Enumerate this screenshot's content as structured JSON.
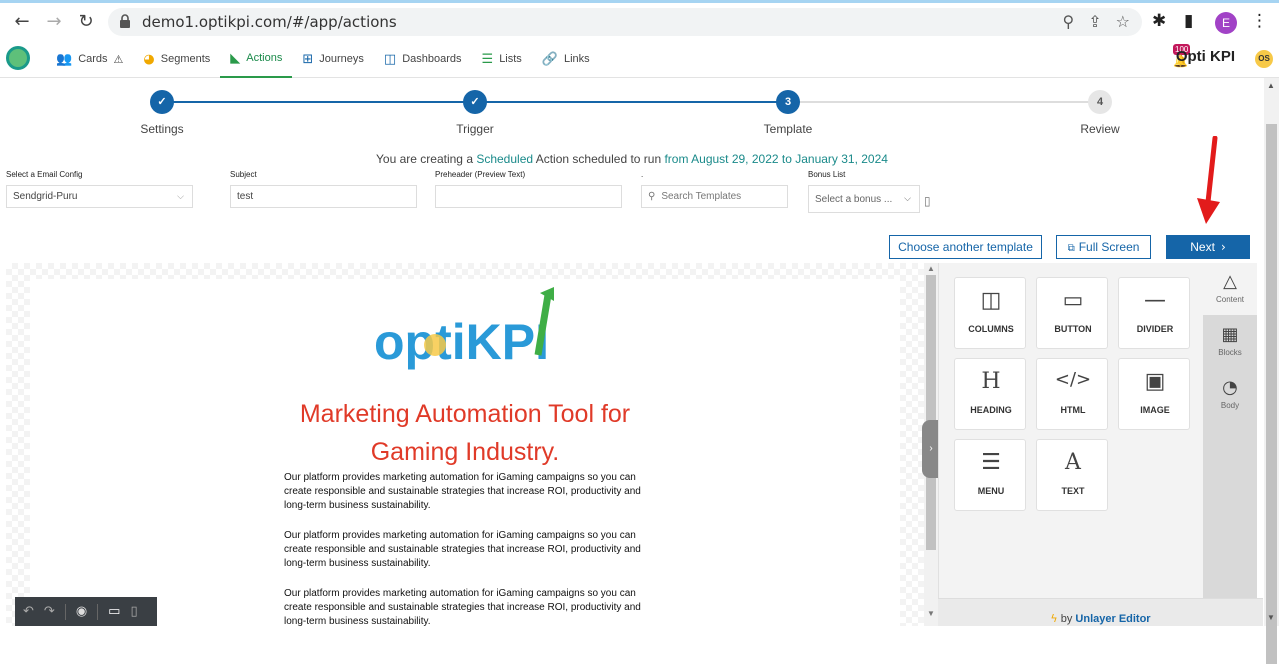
{
  "browser": {
    "url": "demo1.optikpi.com/#/app/actions",
    "profile_initial": "E"
  },
  "nav": {
    "items": [
      {
        "label": "Cards",
        "icon": "users-icon",
        "suffix": "⚠"
      },
      {
        "label": "Segments",
        "icon": "pie-icon"
      },
      {
        "label": "Actions",
        "icon": "megaphone-icon",
        "active": true
      },
      {
        "label": "Journeys",
        "icon": "sitemap-icon"
      },
      {
        "label": "Dashboards",
        "icon": "dashboard-icon"
      },
      {
        "label": "Lists",
        "icon": "list-icon"
      },
      {
        "label": "Links",
        "icon": "link-icon"
      }
    ],
    "brand": "Opti KPI",
    "notification_count": "100",
    "user_initials": "OS"
  },
  "stepper": {
    "steps": [
      {
        "number": "1",
        "label": "Settings",
        "state": "done"
      },
      {
        "number": "2",
        "label": "Trigger",
        "state": "done"
      },
      {
        "number": "3",
        "label": "Template",
        "state": "current"
      },
      {
        "number": "4",
        "label": "Review",
        "state": "todo"
      }
    ]
  },
  "info": {
    "prefix": "You are creating a ",
    "type": "Scheduled",
    "middle": " Action scheduled to run ",
    "range": "from August 29, 2022 to January 31, 2024"
  },
  "form": {
    "email_config_label": "Select a Email Config",
    "email_config_value": "Sendgrid-Puru",
    "subject_label": "Subject",
    "subject_value": "test",
    "preheader_label": "Preheader (Preview Text)",
    "preheader_value": "",
    "search_label": ".",
    "search_placeholder": "Search Templates",
    "bonus_label": "Bonus List",
    "bonus_placeholder": "Select a bonus ..."
  },
  "actions": {
    "choose_template": "Choose another template",
    "full_screen": "Full Screen",
    "next": "Next"
  },
  "email": {
    "logo_text": "optiKPI",
    "title_line1": "Marketing Automation Tool for",
    "title_line2": "Gaming Industry.",
    "paragraph": "Our platform provides marketing automation for iGaming campaigns so you can create responsible and sustainable strategies that increase ROI, productivity and long-term business sustainability."
  },
  "editor": {
    "tiles": [
      {
        "label": "COLUMNS",
        "icon": "columns-icon"
      },
      {
        "label": "BUTTON",
        "icon": "button-icon"
      },
      {
        "label": "DIVIDER",
        "icon": "divider-icon"
      },
      {
        "label": "HEADING",
        "icon": "heading-icon"
      },
      {
        "label": "HTML",
        "icon": "code-icon"
      },
      {
        "label": "IMAGE",
        "icon": "image-icon"
      },
      {
        "label": "MENU",
        "icon": "menu-icon"
      },
      {
        "label": "TEXT",
        "icon": "text-icon"
      }
    ],
    "tabs": [
      {
        "label": "Content",
        "icon": "shapes-icon"
      },
      {
        "label": "Blocks",
        "icon": "grid-icon"
      },
      {
        "label": "Body",
        "icon": "palette-icon"
      }
    ],
    "footer_prefix": "by",
    "footer_link": "Unlayer Editor"
  }
}
